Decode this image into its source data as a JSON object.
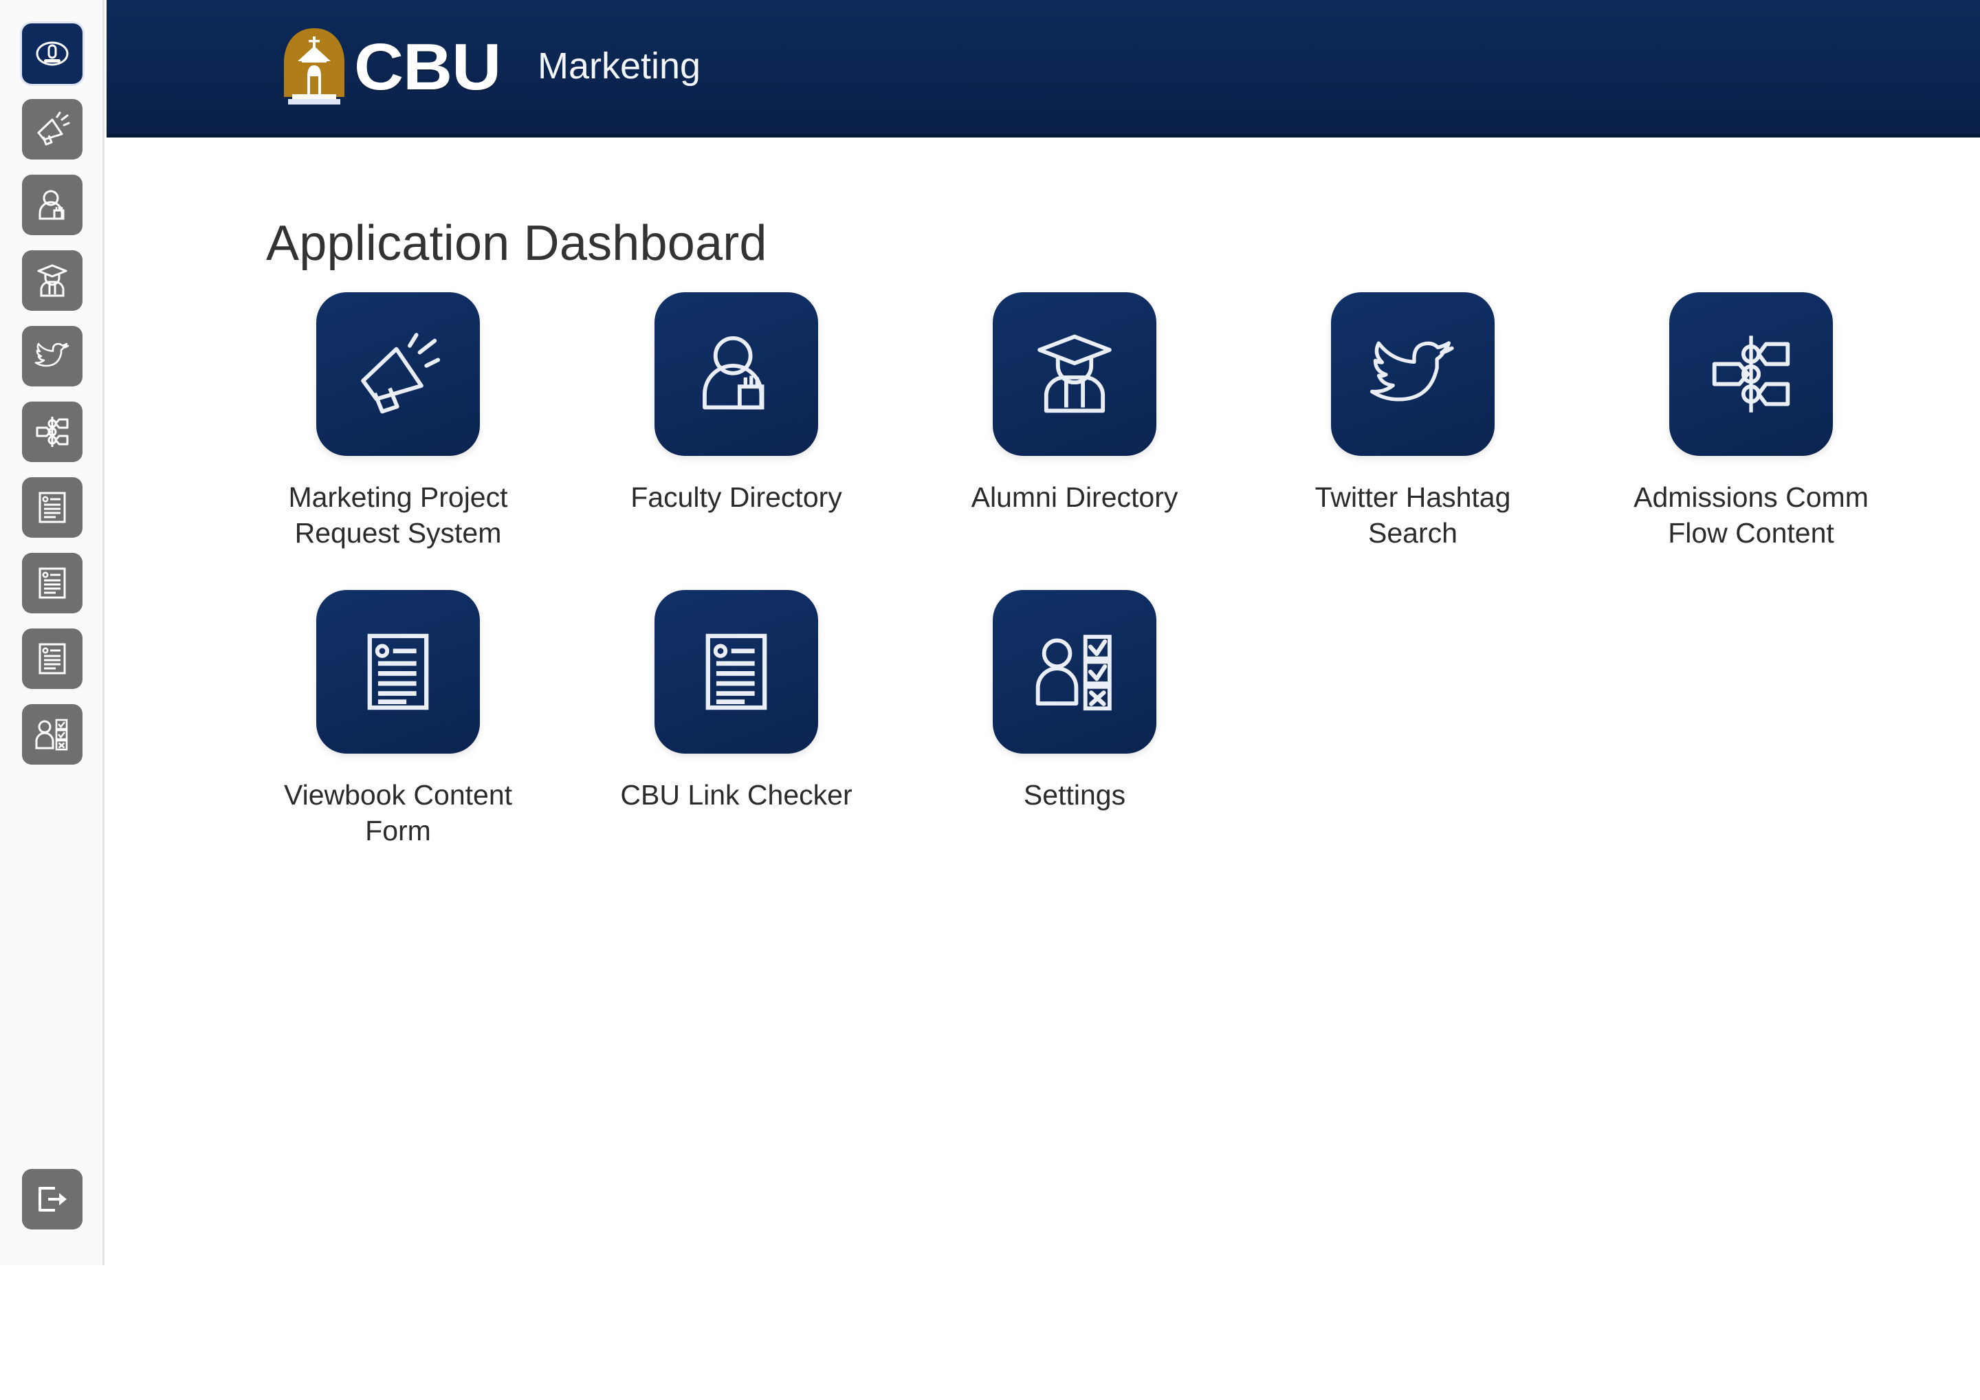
{
  "header": {
    "logo_text": "CBU",
    "logo_icon": "cbu-chapel-arch-logo",
    "department": "Marketing",
    "brand_navy": "#0b2550",
    "brand_gold": "#b8860b"
  },
  "page": {
    "title": "Application Dashboard",
    "background": "#ffffff"
  },
  "sidebar": {
    "items": [
      {
        "name": "dashboard",
        "icon": "dashboard-gauge-icon",
        "active": true
      },
      {
        "name": "marketing-project-request-system",
        "icon": "megaphone-icon",
        "active": false
      },
      {
        "name": "faculty-directory",
        "icon": "person-badge-icon",
        "active": false
      },
      {
        "name": "alumni-directory",
        "icon": "graduate-icon",
        "active": false
      },
      {
        "name": "twitter-hashtag-search",
        "icon": "twitter-bird-icon",
        "active": false
      },
      {
        "name": "admissions-comm-flow-content",
        "icon": "flow-chart-icon",
        "active": false
      },
      {
        "name": "viewbook-content-form",
        "icon": "document-form-icon",
        "active": false
      },
      {
        "name": "cbu-link-checker",
        "icon": "document-form-icon",
        "active": false
      },
      {
        "name": "content-document",
        "icon": "document-form-icon",
        "active": false
      },
      {
        "name": "settings",
        "icon": "person-permissions-icon",
        "active": false
      }
    ],
    "logout": {
      "name": "logout",
      "icon": "logout-exit-icon"
    },
    "inactive_color": "#6f6f6f",
    "active_color": "#0e2a5c"
  },
  "apps": [
    {
      "label": "Marketing Project Request System",
      "icon": "megaphone-icon"
    },
    {
      "label": "Faculty Directory",
      "icon": "person-badge-icon"
    },
    {
      "label": "Alumni Directory",
      "icon": "graduate-icon"
    },
    {
      "label": "Twitter Hashtag Search",
      "icon": "twitter-bird-icon"
    },
    {
      "label": "Admissions Comm Flow Content",
      "icon": "flow-chart-icon"
    },
    {
      "label": "Viewbook Content Form",
      "icon": "document-form-icon"
    },
    {
      "label": "CBU Link Checker",
      "icon": "document-form-icon"
    },
    {
      "label": "Settings",
      "icon": "person-permissions-icon"
    }
  ]
}
